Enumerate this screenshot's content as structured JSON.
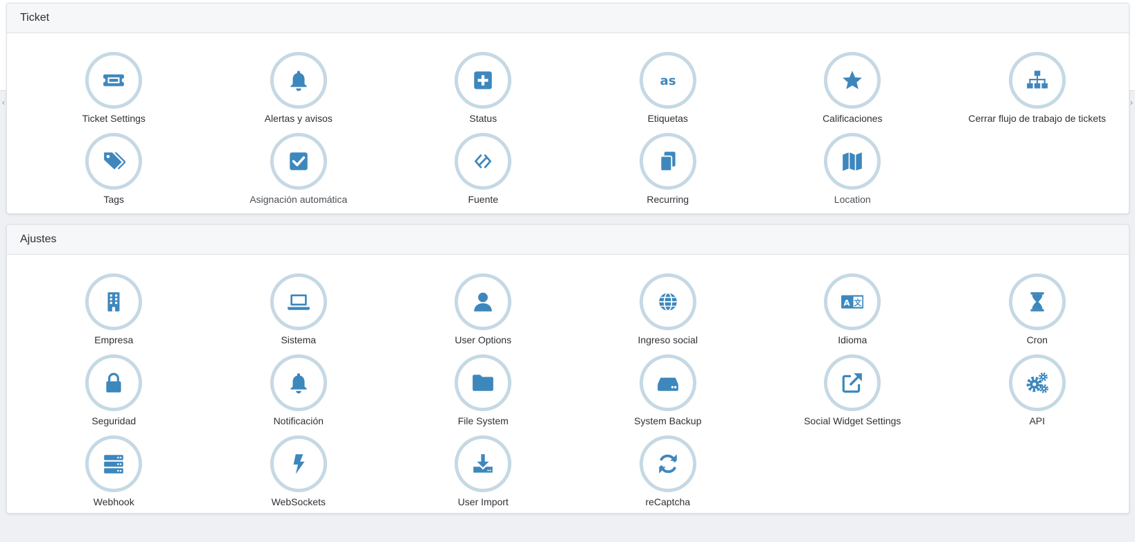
{
  "panels": {
    "ticket": {
      "title": "Ticket",
      "items": [
        {
          "label": "Ticket Settings",
          "icon": "ticket-icon"
        },
        {
          "label": "Alertas y avisos",
          "icon": "bell-icon"
        },
        {
          "label": "Status",
          "icon": "plus-square-icon"
        },
        {
          "label": "Etiquetas",
          "icon": "lastfm-icon"
        },
        {
          "label": "Calificaciones",
          "icon": "star-icon"
        },
        {
          "label": "Cerrar flujo de trabajo de tickets",
          "icon": "sitemap-icon"
        },
        {
          "label": "Tags",
          "icon": "tags-icon"
        },
        {
          "label": "Asignación automática",
          "icon": "check-square-icon"
        },
        {
          "label": "Fuente",
          "icon": "code-fork-icon"
        },
        {
          "label": "Recurring",
          "icon": "copy-icon"
        },
        {
          "label": "Location",
          "icon": "map-icon"
        }
      ]
    },
    "ajustes": {
      "title": "Ajustes",
      "items": [
        {
          "label": "Empresa",
          "icon": "building-icon"
        },
        {
          "label": "Sistema",
          "icon": "laptop-icon"
        },
        {
          "label": "User Options",
          "icon": "user-icon"
        },
        {
          "label": "Ingreso social",
          "icon": "globe-icon"
        },
        {
          "label": "Idioma",
          "icon": "language-icon"
        },
        {
          "label": "Cron",
          "icon": "hourglass-icon"
        },
        {
          "label": "Seguridad",
          "icon": "lock-icon"
        },
        {
          "label": "Notificación",
          "icon": "bell-icon"
        },
        {
          "label": "File System",
          "icon": "folder-icon"
        },
        {
          "label": "System Backup",
          "icon": "hdd-icon"
        },
        {
          "label": "Social Widget Settings",
          "icon": "external-link-icon"
        },
        {
          "label": "API",
          "icon": "cogs-icon"
        },
        {
          "label": "Webhook",
          "icon": "server-icon"
        },
        {
          "label": "WebSockets",
          "icon": "bolt-icon"
        },
        {
          "label": "User Import",
          "icon": "download-icon"
        },
        {
          "label": "reCaptcha",
          "icon": "refresh-icon"
        }
      ]
    }
  },
  "colors": {
    "icon": "#3d87bd",
    "ring": "#c5d8e5"
  }
}
